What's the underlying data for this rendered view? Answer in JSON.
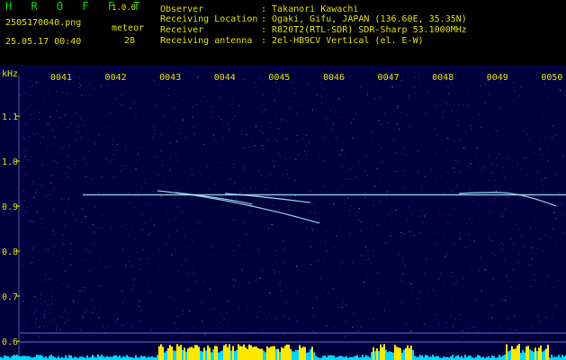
{
  "header": {
    "app_name": "H R O F F T",
    "version": "1.0.0",
    "file_name": "2505170040.png",
    "event_label": "meteor",
    "event_count": "28",
    "datetime": "25.05.17 00:40"
  },
  "info": [
    {
      "key": "Observer",
      "value": ": Takanori Kawachi"
    },
    {
      "key": "Receiving Location",
      "value": ": Ogaki, Gifu, JAPAN (136.60E, 35.35N)"
    },
    {
      "key": "Receiver",
      "value": ": R820T2(RTL-SDR) SDR-Sharp 53.1000MHz"
    },
    {
      "key": "Receiving antenna",
      "value": ": 2el-HB9CV Vertical (el. E-W)"
    }
  ],
  "spectrogram": {
    "y_unit": "kHz",
    "time_ticks": [
      "0041",
      "0042",
      "0043",
      "0044",
      "0045",
      "0046",
      "0047",
      "0048",
      "0049",
      "0050"
    ],
    "freq_ticks": [
      "1.1",
      "1.0",
      "0.9",
      "0.8",
      "0.7",
      "0.6"
    ],
    "carrier_khz": 0.925,
    "colors": {
      "background": "#00003c",
      "noise": "#3030c0",
      "trace": "#a0e8ff",
      "grid": "#8888ff",
      "tick_text": "#e0e000",
      "signal_low": "#00d8ff",
      "signal_high": "#ffe800"
    }
  }
}
